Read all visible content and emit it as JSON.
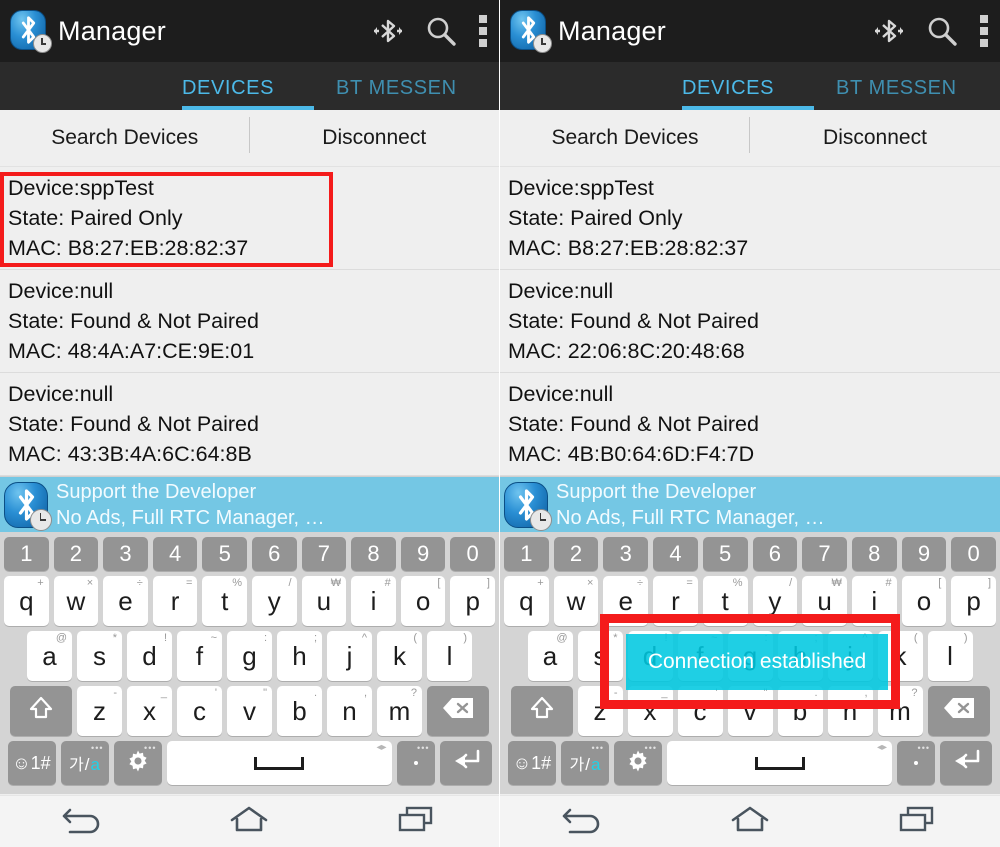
{
  "app": {
    "title": "Manager",
    "icon": "bluetooth-clock-app-icon",
    "actions": [
      {
        "name": "bluetooth-transfer-icon",
        "label": "Bluetooth"
      },
      {
        "name": "search-icon",
        "label": "Search"
      },
      {
        "name": "overflow-menu-icon",
        "label": "More options"
      }
    ]
  },
  "tabs": {
    "active": "DEVICES",
    "inactive": "BT MESSEN"
  },
  "buttons": {
    "search_devices": "Search Devices",
    "disconnect": "Disconnect"
  },
  "labels": {
    "device_prefix": "Device:",
    "state_prefix": "State: ",
    "mac_prefix": "MAC: "
  },
  "panels": [
    {
      "id": "left",
      "devices": [
        {
          "device": "Device:sppTest",
          "state": "State: Paired Only",
          "mac": "MAC: B8:27:EB:28:82:37",
          "highlighted": true
        },
        {
          "device": "Device:null",
          "state": "State: Found & Not Paired",
          "mac": "MAC: 48:4A:A7:CE:9E:01",
          "highlighted": false
        },
        {
          "device": "Device:null",
          "state": "State: Found & Not Paired",
          "mac": "MAC: 43:3B:4A:6C:64:8B",
          "highlighted": false
        }
      ],
      "toast": null
    },
    {
      "id": "right",
      "devices": [
        {
          "device": "Device:sppTest",
          "state": "State: Paired Only",
          "mac": "MAC: B8:27:EB:28:82:37",
          "highlighted": false
        },
        {
          "device": "Device:null",
          "state": "State: Found & Not Paired",
          "mac": "MAC: 22:06:8C:20:48:68",
          "highlighted": false
        },
        {
          "device": "Device:null",
          "state": "State: Found & Not Paired",
          "mac": "MAC: 4B:B0:64:6D:F4:7D",
          "highlighted": false
        }
      ],
      "toast": "Connection established"
    }
  ],
  "ad": {
    "line1": "Support the Developer",
    "line2": "No Ads, Full RTC Manager, …"
  },
  "keyboard": {
    "numbers": [
      "1",
      "2",
      "3",
      "4",
      "5",
      "6",
      "7",
      "8",
      "9",
      "0"
    ],
    "row1": [
      {
        "k": "q",
        "s": "+"
      },
      {
        "k": "w",
        "s": "×"
      },
      {
        "k": "e",
        "s": "÷"
      },
      {
        "k": "r",
        "s": "="
      },
      {
        "k": "t",
        "s": "%"
      },
      {
        "k": "y",
        "s": "/"
      },
      {
        "k": "u",
        "s": "₩"
      },
      {
        "k": "i",
        "s": "#"
      },
      {
        "k": "o",
        "s": "["
      },
      {
        "k": "p",
        "s": "]"
      }
    ],
    "row2": [
      {
        "k": "a",
        "s": "@"
      },
      {
        "k": "s",
        "s": "*"
      },
      {
        "k": "d",
        "s": "!"
      },
      {
        "k": "f",
        "s": "~"
      },
      {
        "k": "g",
        "s": ":"
      },
      {
        "k": "h",
        "s": ";"
      },
      {
        "k": "j",
        "s": "^"
      },
      {
        "k": "k",
        "s": "("
      },
      {
        "k": "l",
        "s": ")"
      }
    ],
    "row3": [
      {
        "k": "z",
        "s": "-"
      },
      {
        "k": "x",
        "s": "_"
      },
      {
        "k": "c",
        "s": "'"
      },
      {
        "k": "v",
        "s": "\""
      },
      {
        "k": "b",
        "s": "."
      },
      {
        "k": "n",
        "s": ","
      },
      {
        "k": "m",
        "s": "?"
      }
    ],
    "shift": "shift-key",
    "backspace": "backspace-key",
    "symbols": "☺1#",
    "lang_ko": "가",
    "lang_en": "a",
    "settings": "gear-key",
    "space": "space-key",
    "period": ".",
    "enter": "enter-key"
  },
  "navbar": [
    {
      "name": "back-button",
      "label": "Back"
    },
    {
      "name": "home-button",
      "label": "Home"
    },
    {
      "name": "recents-button",
      "label": "Recents"
    }
  ],
  "colors": {
    "accent": "#4cb9e8",
    "toast_bg": "#00c8e0",
    "highlight": "#f41b1b",
    "ad_bg": "#74c7e4",
    "actionbar_bg": "#1d1d1d"
  }
}
